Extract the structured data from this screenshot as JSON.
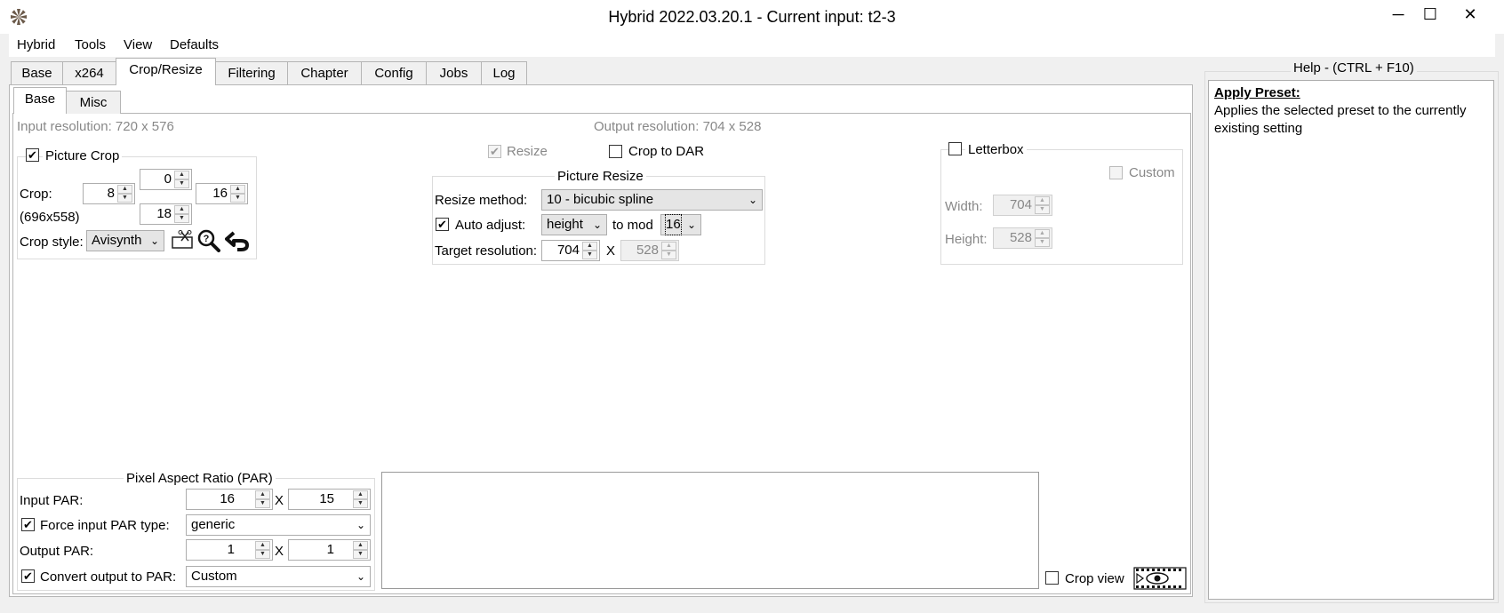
{
  "window": {
    "title": "Hybrid 2022.03.20.1 - Current input: t2-3",
    "minimize": "─",
    "maximize": "☐",
    "close": "✕"
  },
  "menu": [
    "Hybrid",
    "Tools",
    "View",
    "Defaults"
  ],
  "tabs": [
    "Base",
    "x264",
    "Crop/Resize",
    "Filtering",
    "Chapter",
    "Config",
    "Jobs",
    "Log"
  ],
  "active_tab": "Crop/Resize",
  "subtabs": [
    "Base",
    "Misc"
  ],
  "input_resolution": "Input resolution: 720 x 576",
  "output_resolution": "Output resolution: 704 x 528",
  "picture_crop": {
    "label": "Picture Crop",
    "checked": true,
    "crop_label": "Crop:",
    "top": "0",
    "left": "8",
    "right": "16",
    "bottom": "18",
    "size": "(696x558)",
    "style_label": "Crop style:",
    "style_value": "Avisynth"
  },
  "resize": {
    "label": "Resize",
    "checked": true,
    "disabled": true
  },
  "crop_to_dar": {
    "label": "Crop to DAR",
    "checked": false
  },
  "picture_resize": {
    "legend": "Picture Resize",
    "method_label": "Resize method:",
    "method_value": "10 - bicubic spline",
    "auto_adjust_label": "Auto adjust:",
    "auto_adjust_checked": true,
    "auto_adjust_value": "height",
    "to_mod_label": "to mod",
    "mod_value": "16",
    "target_label": "Target resolution:",
    "target_width": "704",
    "x_sep": "X",
    "target_height": "528"
  },
  "letterbox": {
    "label": "Letterbox",
    "checked": false,
    "custom_label": "Custom",
    "width_label": "Width:",
    "width_value": "704",
    "height_label": "Height:",
    "height_value": "528"
  },
  "par": {
    "legend": "Pixel Aspect Ratio (PAR)",
    "input_label": "Input PAR:",
    "input_a": "16",
    "input_b": "15",
    "x_sep": "X",
    "force_label": "Force input PAR type:",
    "force_checked": true,
    "force_value": "generic",
    "output_label": "Output PAR:",
    "output_a": "1",
    "output_b": "1",
    "convert_label": "Convert output to PAR:",
    "convert_checked": true,
    "convert_value": "Custom"
  },
  "crop_view": {
    "label": "Crop view",
    "checked": false
  },
  "help": {
    "title": "Help - (CTRL + F10)",
    "heading": "Apply Preset:",
    "body": "Applies the selected preset to the currently existing setting"
  },
  "check_glyph": "✔",
  "arrow_up": "▲",
  "arrow_down": "▼",
  "chevron": "⌄"
}
